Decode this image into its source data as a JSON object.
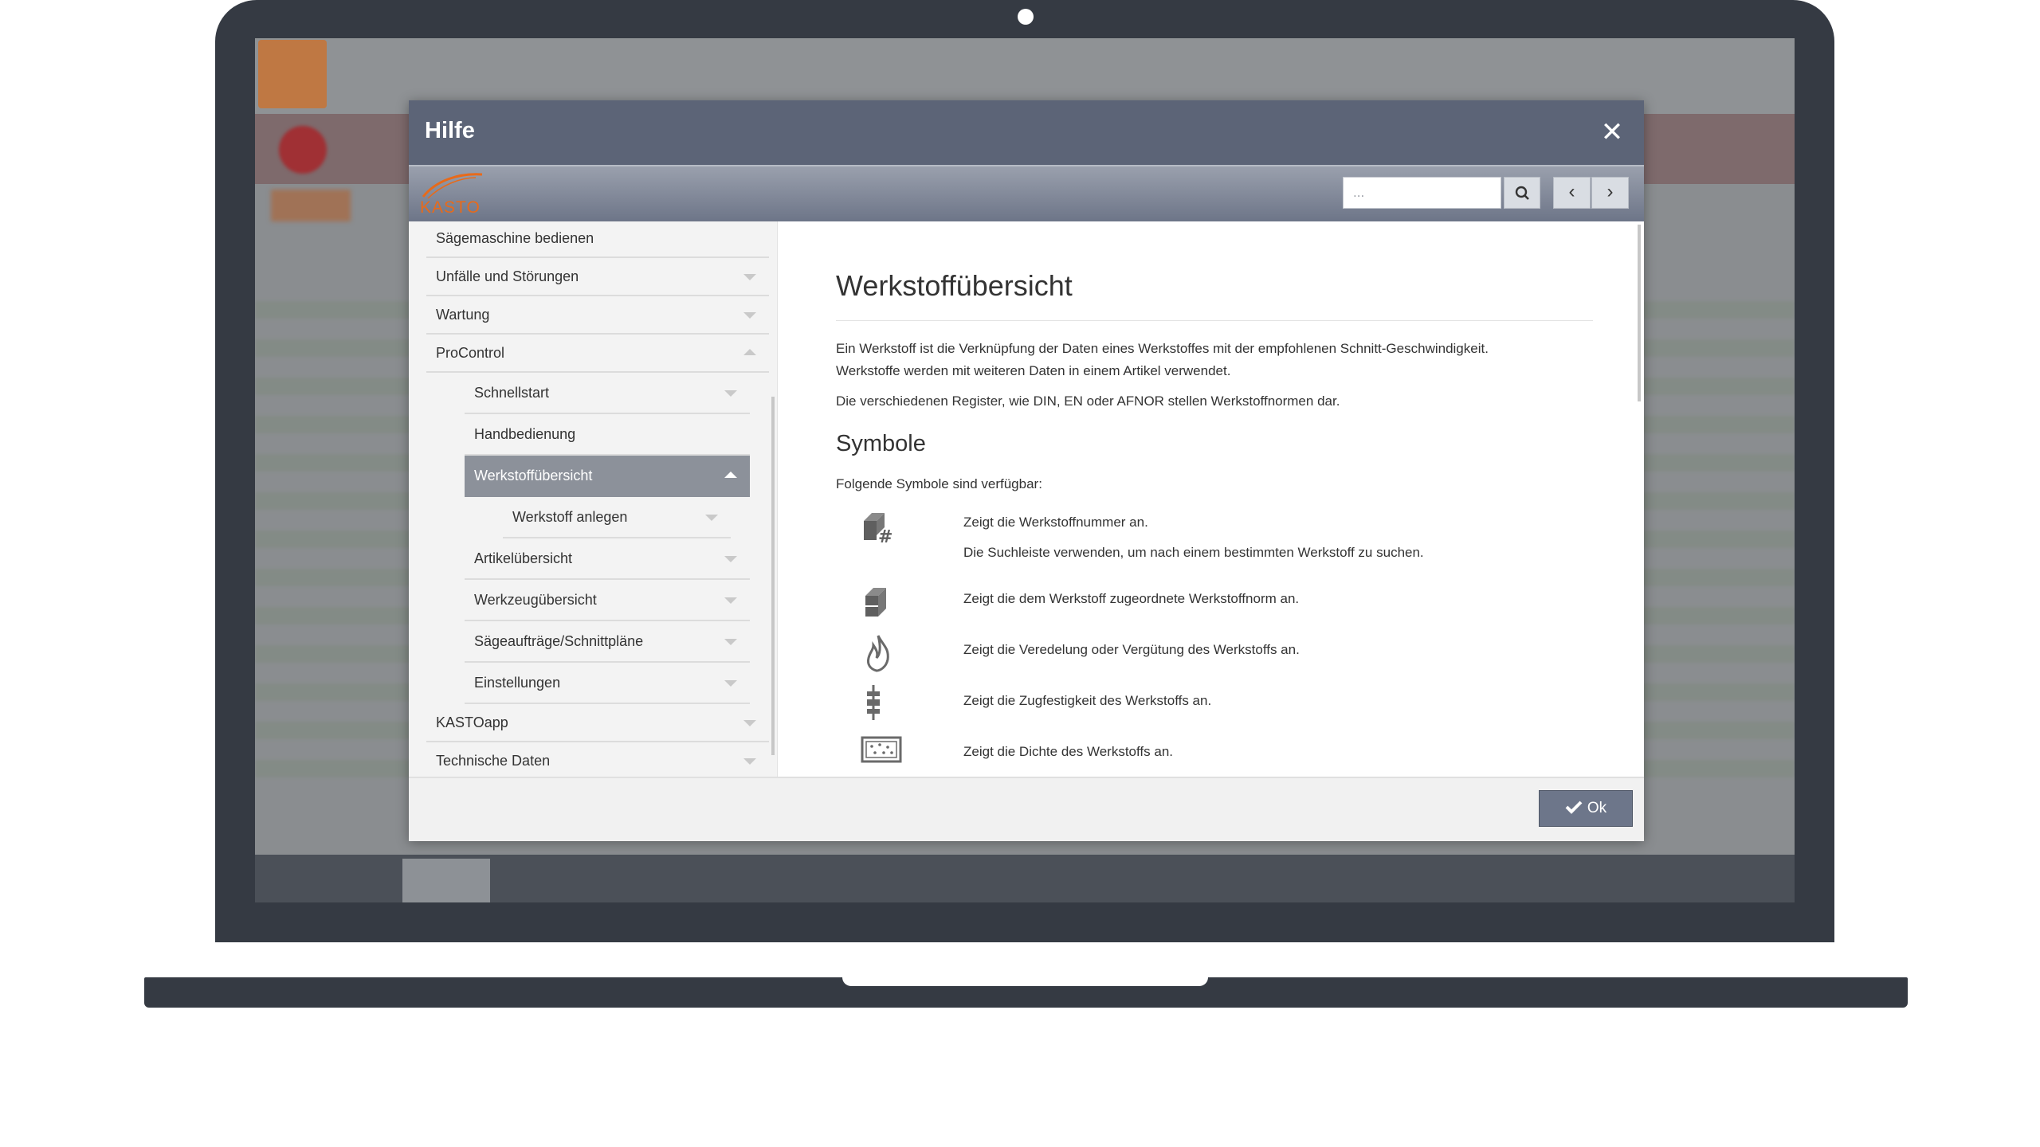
{
  "dialog": {
    "title": "Hilfe",
    "close_glyph": "✕",
    "brand": "KASTO",
    "search": {
      "placeholder": "..."
    },
    "nav_prev": "‹",
    "nav_next": "›",
    "ok_label": "Ok"
  },
  "sidebar": {
    "items": [
      {
        "label": "Sägemaschine bedienen",
        "state": "none"
      },
      {
        "label": "Unfälle und Störungen",
        "state": "collapsed"
      },
      {
        "label": "Wartung",
        "state": "collapsed"
      },
      {
        "label": "ProControl",
        "state": "expanded"
      },
      {
        "label": "Schnellstart",
        "state": "collapsed"
      },
      {
        "label": "Handbedienung",
        "state": "none"
      },
      {
        "label": "Werkstoffübersicht",
        "state": "active"
      },
      {
        "label": "Werkstoff anlegen",
        "state": "collapsed"
      },
      {
        "label": "Artikelübersicht",
        "state": "collapsed"
      },
      {
        "label": "Werkzeugübersicht",
        "state": "collapsed"
      },
      {
        "label": "Sägeaufträge/Schnittpläne",
        "state": "collapsed"
      },
      {
        "label": "Einstellungen",
        "state": "collapsed"
      },
      {
        "label": "KASTOapp",
        "state": "collapsed"
      },
      {
        "label": "Technische Daten",
        "state": "collapsed"
      }
    ]
  },
  "content": {
    "title": "Werkstoffübersicht",
    "intro_line1": "Ein Werkstoff ist die Verknüpfung der Daten eines Werkstoffes mit der empfohlenen Schnitt-Geschwindigkeit.",
    "intro_line2": "Werkstoffe werden mit weiteren Daten in einem Artikel verwendet.",
    "registers": "Die verschiedenen Register, wie DIN, EN oder AFNOR stellen Werkstoffnormen dar.",
    "symbols_heading": "Symbole",
    "symbols_intro": "Folgende Symbole sind verfügbar:",
    "symbols": [
      {
        "icon": "material-number-icon",
        "text": "Zeigt die Werkstoffnummer an.",
        "note": "Die Suchleiste verwenden, um nach einem bestimmten Werkstoff zu suchen."
      },
      {
        "icon": "material-norm-icon",
        "text": "Zeigt die dem Werkstoff zugeordnete Werkstoffnorm an."
      },
      {
        "icon": "flame-icon",
        "text": "Zeigt die Veredelung oder Vergütung des Werkstoffs an."
      },
      {
        "icon": "tensile-strength-icon",
        "text": "Zeigt die Zugfestigkeit des Werkstoffs an."
      },
      {
        "icon": "density-icon",
        "text": "Zeigt die Dichte des Werkstoffs an."
      }
    ]
  },
  "colors": {
    "header": "#5c6477",
    "brand_orange": "#e86a1a",
    "active_nav": "#8c919a",
    "ok_button": "#6d768a"
  }
}
